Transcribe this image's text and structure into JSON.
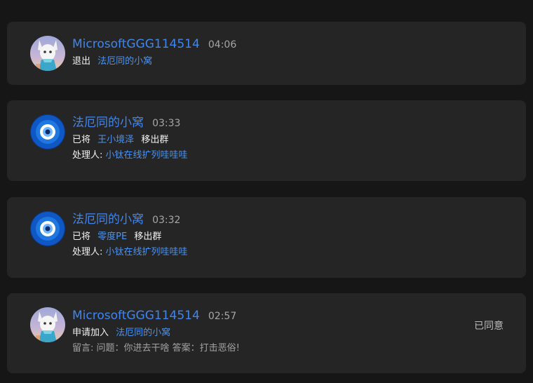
{
  "notices": [
    {
      "name": "MicrosoftGGG114514",
      "time": "04:06",
      "action": "退出",
      "group": "法厄同的小窝"
    },
    {
      "name": "法厄同的小窝",
      "time": "03:33",
      "prefix": "已将",
      "target": "王小境泽",
      "suffix": "移出群",
      "handler_label": "处理人:",
      "handler": "小钛在线扩列哇哇哇"
    },
    {
      "name": "法厄同的小窝",
      "time": "03:32",
      "prefix": "已将",
      "target": "零度PE",
      "suffix": "移出群",
      "handler_label": "处理人:",
      "handler": "小钛在线扩列哇哇哇"
    },
    {
      "name": "MicrosoftGGG114514",
      "time": "02:57",
      "action": "申请加入",
      "group": "法厄同的小窝",
      "message": "留言: 问题：你进去干啥 答案：打击恶俗!",
      "status": "已同意"
    }
  ],
  "icons": {
    "user_avatar": "anime-character-avatar-icon",
    "group_avatar": "blue-eye-group-icon"
  },
  "colors": {
    "background": "#161616",
    "card": "#252525",
    "link": "#4a93f3",
    "name": "#3f86ee"
  }
}
